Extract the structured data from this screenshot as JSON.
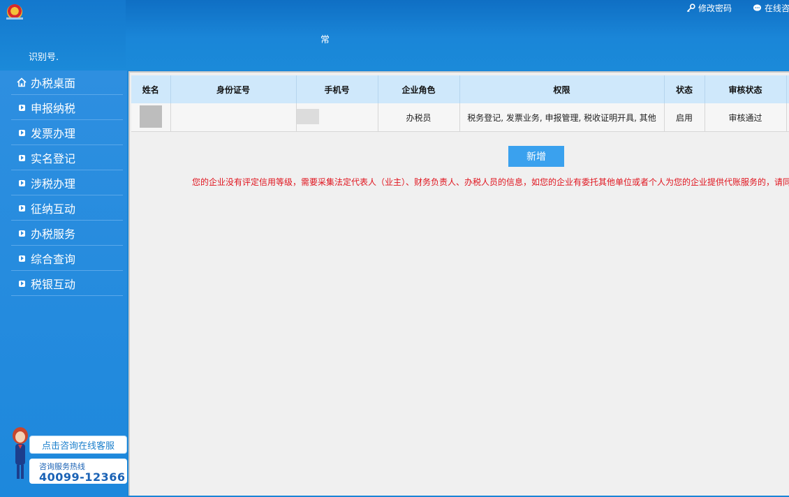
{
  "header": {
    "change_password": "修改密码",
    "online_consult": "在线咨",
    "title": "常",
    "taxpayer_id_label": "识别号."
  },
  "sidebar": {
    "items": [
      {
        "label": "办税桌面",
        "icon": "home-icon"
      },
      {
        "label": "申报纳税",
        "icon": "arrow-square-icon"
      },
      {
        "label": "发票办理",
        "icon": "arrow-square-icon"
      },
      {
        "label": "实名登记",
        "icon": "arrow-square-icon"
      },
      {
        "label": "涉税办理",
        "icon": "arrow-square-icon"
      },
      {
        "label": "征纳互动",
        "icon": "arrow-square-icon"
      },
      {
        "label": "办税服务",
        "icon": "arrow-square-icon"
      },
      {
        "label": "综合查询",
        "icon": "arrow-square-icon"
      },
      {
        "label": "税银互动",
        "icon": "arrow-square-icon"
      }
    ],
    "cs_button": "点击咨询在线客服",
    "hotline_label": "咨询服务热线",
    "hotline_number": "40099-12366"
  },
  "table": {
    "headers": [
      "姓名",
      "身份证号",
      "手机号",
      "企业角色",
      "权限",
      "状态",
      "审核状态"
    ],
    "rows": [
      {
        "name": "",
        "id_no": "",
        "phone": "",
        "role": "办税员",
        "permissions": "税务登记, 发票业务, 申报管理, 税收证明开具, 其他",
        "status": "启用",
        "audit_status": "审核通过"
      }
    ]
  },
  "add_button": "新增",
  "notice": "您的企业没有评定信用等级，需要采集法定代表人（业主）、财务负责人、办税人员的信息，如您的企业有委托其他单位或者个人为您的企业提供代账服务的，请同",
  "colors": {
    "header_blue": "#1a86d8",
    "table_header": "#cfe8fb",
    "add_button": "#3aa1ee",
    "notice_red": "#e0141e"
  }
}
